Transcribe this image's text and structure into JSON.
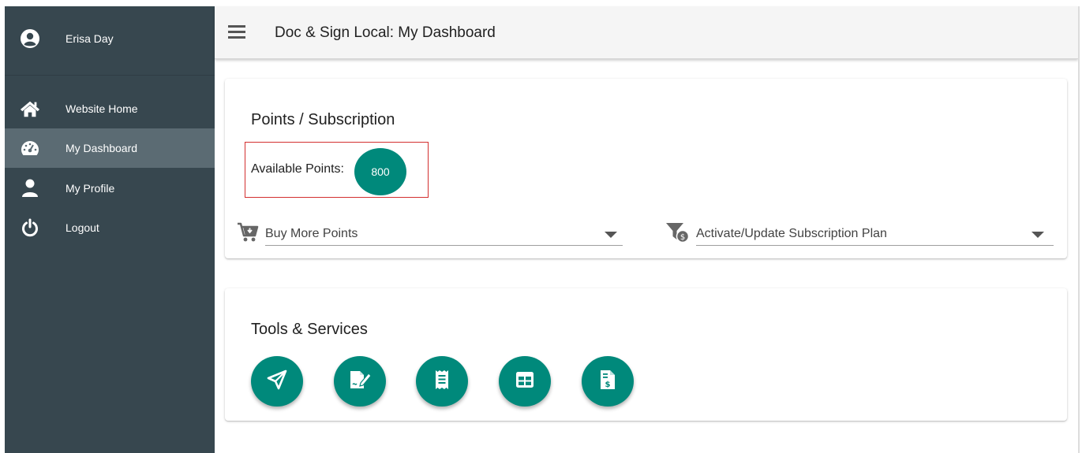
{
  "sidebar": {
    "user": {
      "name": "Erisa Day",
      "icon": "account-circle-icon"
    },
    "items": [
      {
        "label": "Website Home",
        "icon": "home-icon",
        "active": false
      },
      {
        "label": "My Dashboard",
        "icon": "dashboard-gauge-icon",
        "active": true
      },
      {
        "label": "My Profile",
        "icon": "person-icon",
        "active": false
      },
      {
        "label": "Logout",
        "icon": "power-icon",
        "active": false
      }
    ]
  },
  "header": {
    "menu_icon": "hamburger-menu-icon",
    "title": "Doc & Sign Local: My Dashboard"
  },
  "points_card": {
    "title": "Points / Subscription",
    "available_label": "Available Points:",
    "available_value": "800",
    "buy_select": {
      "label": "Buy More Points",
      "icon": "cart-arrow-down-icon"
    },
    "subscription_select": {
      "label": "Activate/Update Subscription Plan",
      "icon": "filter-dollar-icon"
    }
  },
  "tools_card": {
    "title": "Tools & Services",
    "tools": [
      {
        "icon": "send-paper-plane-icon"
      },
      {
        "icon": "document-sign-icon"
      },
      {
        "icon": "receipt-icon"
      },
      {
        "icon": "table-grid-icon"
      },
      {
        "icon": "invoice-dollar-icon"
      }
    ]
  },
  "colors": {
    "sidebar_bg": "#37474f",
    "sidebar_active": "#5b6b73",
    "accent_teal": "#00897b",
    "highlight_red": "#d32f2f"
  }
}
